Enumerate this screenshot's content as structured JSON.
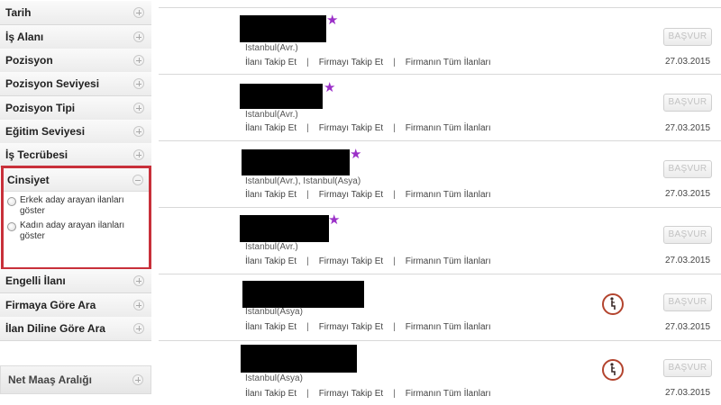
{
  "sidebar": {
    "filters": [
      {
        "label": "Tarih"
      },
      {
        "label": "İş Alanı"
      },
      {
        "label": "Pozisyon"
      },
      {
        "label": "Pozisyon Seviyesi"
      },
      {
        "label": "Pozisyon Tipi"
      },
      {
        "label": "Eğitim Seviyesi"
      },
      {
        "label": "İş Tecrübesi"
      }
    ],
    "cinsiyet": {
      "label": "Cinsiyet",
      "options": [
        {
          "label": "Erkek aday arayan ilanları göster",
          "checked": false
        },
        {
          "label": "Kadın aday arayan ilanları göster",
          "checked": false
        }
      ]
    },
    "filters_after": [
      {
        "label": "Engelli İlanı"
      },
      {
        "label": "Firmaya Göre Ara"
      },
      {
        "label": "İlan Diline Göre Ara"
      }
    ],
    "salary": {
      "label": "Net Maaş Aralığı"
    }
  },
  "listing_links": {
    "follow_listing": "İlanı Takip Et",
    "follow_company": "Firmayı Takip Et",
    "all_company_listings": "Firmanın Tüm İlanları",
    "separator": "|"
  },
  "listings": [
    {
      "location": "Istanbul(Avr.)",
      "apply": "BAŞVUR",
      "date": "27.03.2015",
      "starred": true,
      "disability": false
    },
    {
      "location": "Istanbul(Avr.)",
      "apply": "BAŞVUR",
      "date": "27.03.2015",
      "starred": true,
      "disability": false
    },
    {
      "location": "Istanbul(Avr.), Istanbul(Asya)",
      "apply": "BAŞVUR",
      "date": "27.03.2015",
      "starred": true,
      "disability": false
    },
    {
      "location": "Istanbul(Avr.)",
      "apply": "BAŞVUR",
      "date": "27.03.2015",
      "starred": true,
      "disability": false
    },
    {
      "location": "Istanbul(Asya)",
      "apply": "BAŞVUR",
      "date": "27.03.2015",
      "starred": false,
      "disability": true
    },
    {
      "location": "Istanbul(Asya)",
      "apply": "BAŞVUR",
      "date": "27.03.2015",
      "starred": false,
      "disability": true
    }
  ],
  "colors": {
    "star": "#9b30c8",
    "highlight_border": "#c8303a",
    "disability_icon": "#b3442e"
  }
}
